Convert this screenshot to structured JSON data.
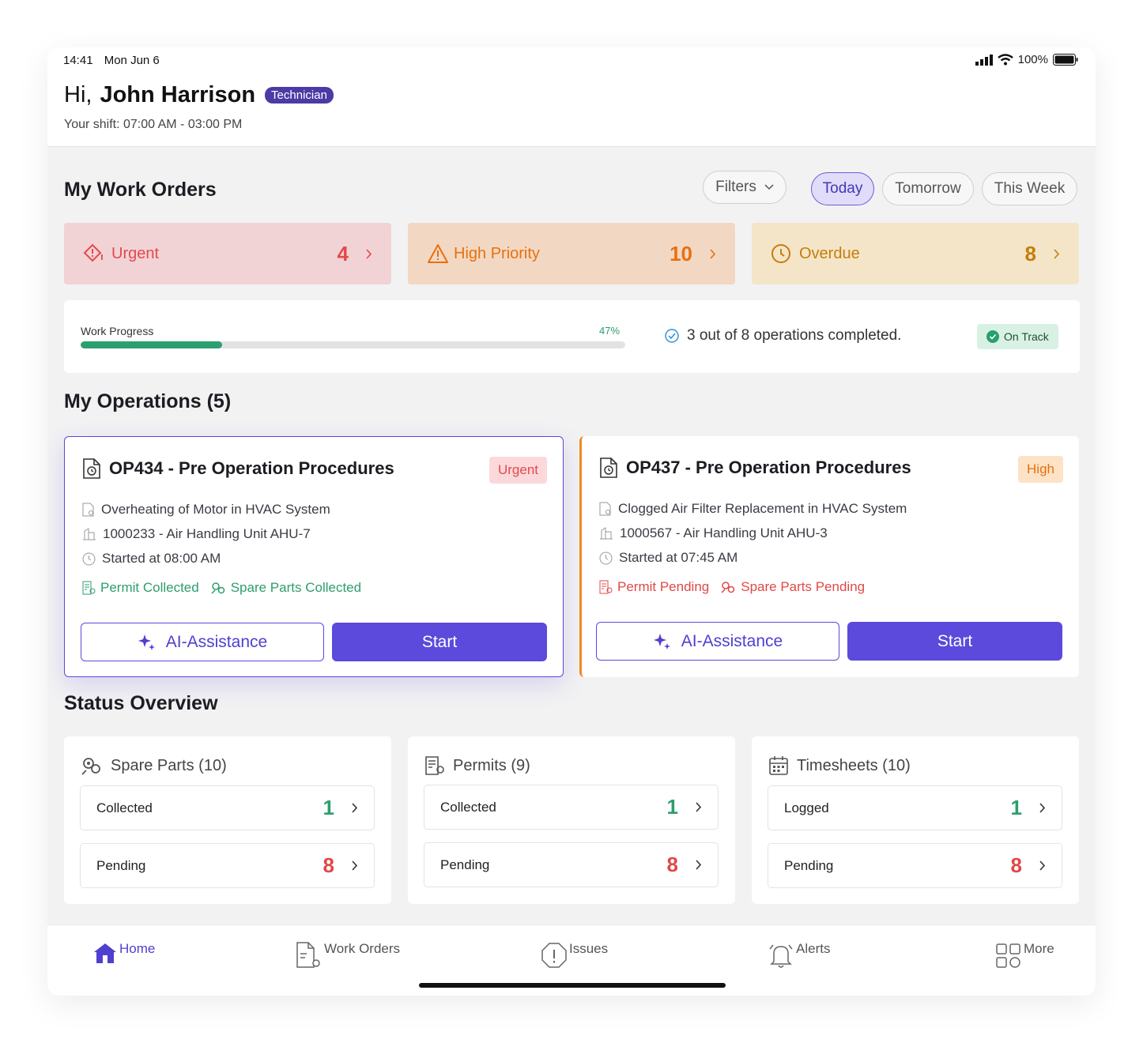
{
  "status_bar": {
    "time": "14:41",
    "date": "Mon Jun 6",
    "battery": "100%"
  },
  "header": {
    "greeting": "Hi,",
    "name": "John Harrison",
    "role": "Technician",
    "shift": "Your shift: 07:00 AM - 03:00 PM"
  },
  "work_orders": {
    "title": "My Work Orders",
    "filters_label": "Filters",
    "periods": [
      "Today",
      "Tomorrow",
      "This Week"
    ],
    "active_period": "Today",
    "priorities": [
      {
        "label": "Urgent",
        "count": "4",
        "color": "#e5484d",
        "bg": "#f2d3d5"
      },
      {
        "label": "High Priority",
        "count": "10",
        "color": "#e8700f",
        "bg": "#f2d8c3"
      },
      {
        "label": "Overdue",
        "count": "8",
        "color": "#c57d0b",
        "bg": "#f4e5c8"
      }
    ]
  },
  "progress": {
    "label": "Work Progress",
    "percent_text": "47%",
    "fraction": 0.26,
    "summary": "3 out of 8 operations completed.",
    "status": "On Track"
  },
  "operations": {
    "title": "My Operations (5)",
    "items": [
      {
        "title": "OP434 - Pre Operation Procedures",
        "priority": "Urgent",
        "issue": "Overheating of Motor in HVAC System",
        "asset": "1000233 - Air Handling Unit AHU-7",
        "started": "Started at 08:00 AM",
        "permit": "Permit Collected",
        "spare_parts": "Spare Parts Collected",
        "ai_label": "AI-Assistance",
        "start_label": "Start"
      },
      {
        "title": "OP437 - Pre Operation Procedures",
        "priority": "High",
        "issue": "Clogged Air Filter Replacement in HVAC System",
        "asset": "1000567 - Air Handling Unit AHU-3",
        "started": "Started at 07:45 AM",
        "permit": "Permit Pending",
        "spare_parts": "Spare Parts Pending",
        "ai_label": "AI-Assistance",
        "start_label": "Start"
      }
    ]
  },
  "status_overview": {
    "title": "Status Overview",
    "cards": [
      {
        "title": "Spare Parts (10)",
        "icon": "gears-icon",
        "rows": [
          {
            "label": "Collected",
            "value": "1"
          },
          {
            "label": "Pending",
            "value": "8"
          }
        ]
      },
      {
        "title": "Permits (9)",
        "icon": "permit-icon",
        "rows": [
          {
            "label": "Collected",
            "value": "1"
          },
          {
            "label": "Pending",
            "value": "8"
          }
        ]
      },
      {
        "title": "Timesheets (10)",
        "icon": "calendar-icon",
        "rows": [
          {
            "label": "Logged",
            "value": "1"
          },
          {
            "label": "Pending",
            "value": "8"
          }
        ]
      }
    ]
  },
  "bottom_nav": [
    "Home",
    "Work Orders",
    "Issues",
    "Alerts",
    "More"
  ],
  "colors": {
    "accent": "#5b4adb",
    "success": "#2e9d6e",
    "danger": "#e04848"
  }
}
